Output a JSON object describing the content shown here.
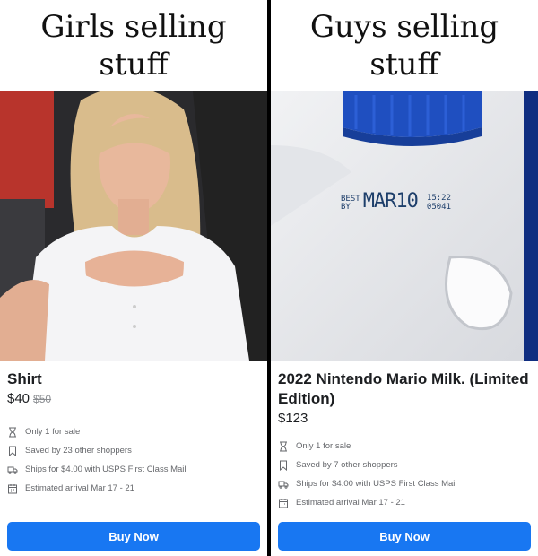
{
  "panels": [
    {
      "caption_line1": "Girls selling",
      "caption_line2": "stuff",
      "title": "Shirt",
      "price": "$40",
      "old_price": "$50",
      "details": [
        {
          "icon": "hourglass-icon",
          "text": "Only 1 for sale"
        },
        {
          "icon": "bookmark-icon",
          "text": "Saved by 23 other shoppers"
        },
        {
          "icon": "truck-icon",
          "text": "Ships for $4.00 with USPS First Class Mail"
        },
        {
          "icon": "calendar-icon",
          "text": "Estimated arrival Mar 17 - 21"
        }
      ],
      "button": "Buy Now"
    },
    {
      "caption_line1": "Guys selling",
      "caption_line2": "stuff",
      "title": "2022 Nintendo Mario Milk. (Limited Edition)",
      "price": "$123",
      "stamp": {
        "best": "BEST",
        "by": "BY",
        "date": "MAR10",
        "time": "15:22",
        "code": "05041"
      },
      "details": [
        {
          "icon": "hourglass-icon",
          "text": "Only 1 for sale"
        },
        {
          "icon": "bookmark-icon",
          "text": "Saved by 7 other shoppers"
        },
        {
          "icon": "truck-icon",
          "text": "Ships for $4.00 with USPS First Class Mail"
        },
        {
          "icon": "calendar-icon",
          "text": "Estimated arrival Mar 17 - 21"
        }
      ],
      "button": "Buy Now"
    }
  ],
  "colors": {
    "button": "#1877f2",
    "detail_text": "#65676b",
    "cap_blue": "#1f4fc0"
  }
}
